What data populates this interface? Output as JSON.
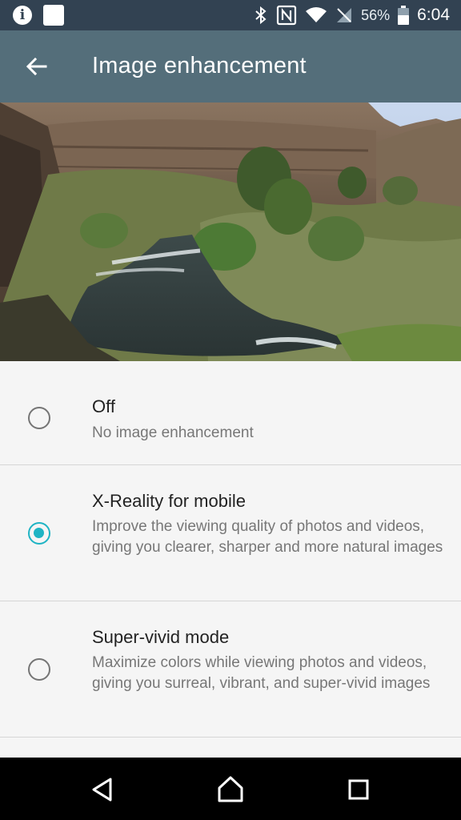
{
  "status_bar": {
    "battery_percent": "56%",
    "time": "6:04",
    "icons": [
      "info-icon",
      "square-icon",
      "bluetooth-icon",
      "nfc-icon",
      "wifi-icon",
      "no-sim-icon",
      "battery-icon"
    ]
  },
  "app_bar": {
    "title": "Image enhancement",
    "back_icon": "arrow-left-icon"
  },
  "hero": {
    "image": "landscape-river-canyon"
  },
  "options": [
    {
      "title": "Off",
      "description": "No image enhancement",
      "selected": false
    },
    {
      "title": "X-Reality for mobile",
      "description": "Improve the viewing quality of photos and videos, giving you clearer, sharper and more natural images",
      "selected": true
    },
    {
      "title": "Super-vivid mode",
      "description": "Maximize colors while viewing photos and videos, giving you surreal, vibrant, and super-vivid images",
      "selected": false
    }
  ],
  "colors": {
    "status_bar": "#324252",
    "app_bar": "#546e7a",
    "accent": "#1fb4c4",
    "background": "#f5f5f5"
  },
  "nav_bar": {
    "icons": [
      "back-triangle-icon",
      "home-icon",
      "recents-icon"
    ]
  }
}
